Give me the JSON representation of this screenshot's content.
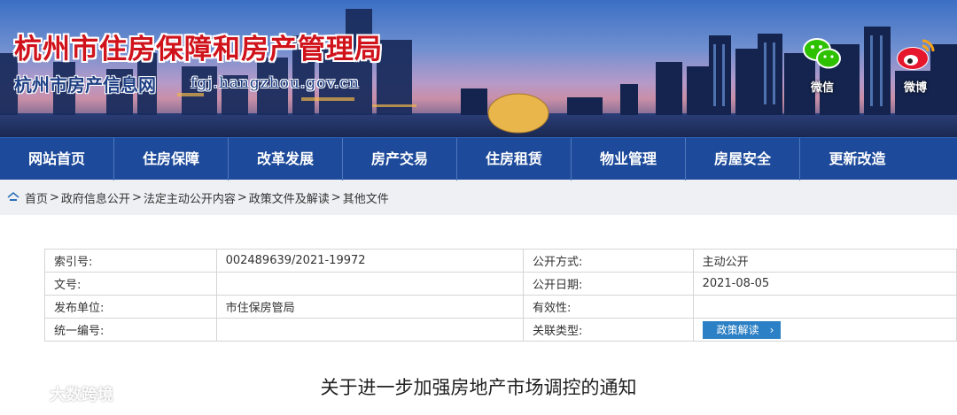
{
  "header": {
    "title": "杭州市住房保障和房产管理局",
    "subtitle": "杭州市房产信息网",
    "url": "fgj.hangzhou.gov.cn",
    "social": [
      {
        "label": "微信",
        "icon": "wechat-icon"
      },
      {
        "label": "微博",
        "icon": "weibo-icon"
      }
    ]
  },
  "nav": {
    "items": [
      "网站首页",
      "住房保障",
      "改革发展",
      "房产交易",
      "住房租赁",
      "物业管理",
      "房屋安全",
      "更新改造"
    ]
  },
  "breadcrumb": {
    "items": [
      "首页",
      "政府信息公开",
      "法定主动公开内容",
      "政策文件及解读",
      "其他文件"
    ],
    "separator": ">"
  },
  "meta": {
    "index_label": "索引号:",
    "index_value": "002489639/2021-19972",
    "public_mode_label": "公开方式:",
    "public_mode_value": "主动公开",
    "doc_no_label": "文号:",
    "doc_no_value": "",
    "public_date_label": "公开日期:",
    "public_date_value": "2021-08-05",
    "publisher_label": "发布单位:",
    "publisher_value": "市住保房管局",
    "validity_label": "有效性:",
    "validity_value": "",
    "unified_no_label": "统一编号:",
    "unified_no_value": "",
    "related_type_label": "关联类型:",
    "related_button": "政策解读"
  },
  "document": {
    "title": "关于进一步加强房地产市场调控的通知"
  },
  "watermark": {
    "text": "大数跨境"
  },
  "colors": {
    "nav_bg": "#1d4a9a",
    "title_red": "#d0121b",
    "button_blue": "#2c80c5"
  }
}
